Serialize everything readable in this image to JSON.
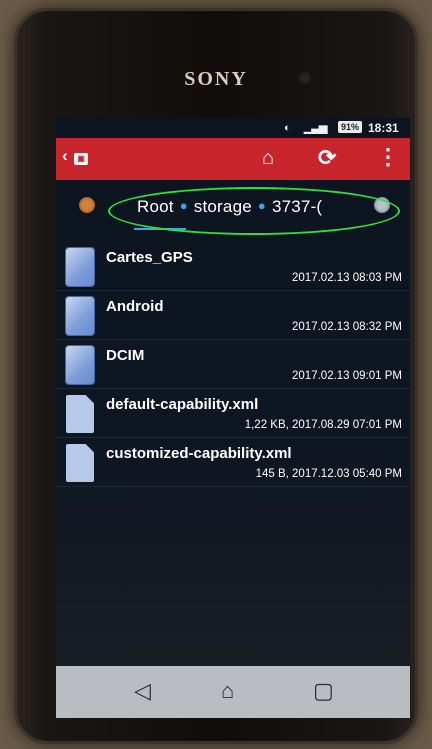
{
  "device": {
    "brand": "SONY"
  },
  "statusbar": {
    "battery": "91%",
    "time": "18:31"
  },
  "appbar": {
    "app_icon": "app-logo-icon",
    "home_icon": "home-icon",
    "refresh_icon": "refresh-icon",
    "overflow_icon": "more-vert-icon"
  },
  "breadcrumb": {
    "items": [
      "Root",
      "storage",
      "3737-("
    ],
    "highlight_color": "#2fe03a",
    "accent_color": "#3aa6e8"
  },
  "files": [
    {
      "name": "Cartes_GPS",
      "meta": "2017.02.13 08:03 PM",
      "type": "folder"
    },
    {
      "name": "Android",
      "meta": "2017.02.13 08:32 PM",
      "type": "folder"
    },
    {
      "name": "DCIM",
      "meta": "2017.02.13 09:01 PM",
      "type": "folder"
    },
    {
      "name": "default-capability.xml",
      "meta": "1,22 KB, 2017.08.29 07:01 PM",
      "type": "file"
    },
    {
      "name": "customized-capability.xml",
      "meta": "145 B, 2017.12.03 05:40 PM",
      "type": "file"
    }
  ],
  "colors": {
    "appbar": "#c8242c",
    "navbar": "#b9bcc0"
  },
  "navbar": {
    "back_icon": "back-icon",
    "home_icon": "home-icon",
    "recents_icon": "recents-icon"
  }
}
